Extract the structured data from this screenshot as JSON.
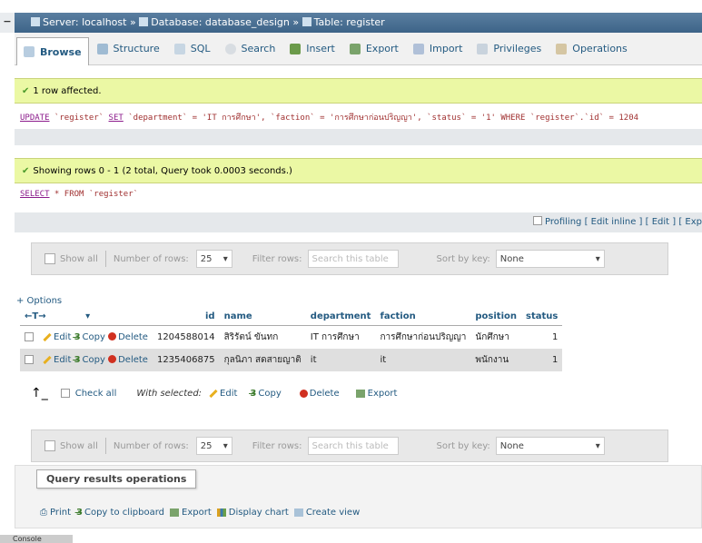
{
  "breadcrumb": {
    "server": "Server: localhost",
    "database": "Database: database_design",
    "table": "Table: register",
    "separator": "»"
  },
  "tabs": [
    {
      "label": "Browse",
      "icon": "browse-icon"
    },
    {
      "label": "Structure",
      "icon": "structure-icon"
    },
    {
      "label": "SQL",
      "icon": "sql-icon"
    },
    {
      "label": "Search",
      "icon": "search-icon"
    },
    {
      "label": "Insert",
      "icon": "insert-icon"
    },
    {
      "label": "Export",
      "icon": "export-icon"
    },
    {
      "label": "Import",
      "icon": "import-icon"
    },
    {
      "label": "Privileges",
      "icon": "privileges-icon"
    },
    {
      "label": "Operations",
      "icon": "operations-icon"
    }
  ],
  "update_msg": {
    "text": "1 row affected.",
    "sql_kw": "UPDATE",
    "sql_rest": " `register` ",
    "sql_kw2": "SET",
    "sql_tail": " `department` = 'IT การศึกษา', `faction` = 'การศึกษาก่อนปริญญา', `status` = '1' WHERE `register`.`id` = 1204"
  },
  "select_msg": {
    "text": "Showing rows 0 - 1 (2 total, Query took 0.0003 seconds.)",
    "sql_kw": "SELECT",
    "sql_rest": " * FROM `register`"
  },
  "profiling": {
    "label": "Profiling",
    "links": "[ Edit inline ] [ Edit ] [ Exp"
  },
  "nav": {
    "show_all": "Show all",
    "number_of_rows_label": "Number of rows:",
    "number_of_rows": "25",
    "filter_rows_label": "Filter rows:",
    "filter_placeholder": "Search this table",
    "sort_by_key_label": "Sort by key:",
    "sort_by_key": "None"
  },
  "options_label": "+ Options",
  "columns": [
    "id",
    "name",
    "department",
    "faction",
    "position",
    "status"
  ],
  "rows": [
    {
      "id": "1204588014",
      "name": "สิริรัตน์ ขันทก",
      "department": "IT การศึกษา",
      "faction": "การศึกษาก่อนปริญญา",
      "position": "นักศึกษา",
      "status": "1"
    },
    {
      "id": "1235406875",
      "name": "กุลนิภา สดสายญาติ",
      "department": "it",
      "faction": "it",
      "position": "พนักงาน",
      "status": "1"
    }
  ],
  "row_actions": {
    "edit": "Edit",
    "copy": "Copy",
    "delete": "Delete"
  },
  "bulk": {
    "check_all": "Check all",
    "with_selected": "With selected:",
    "edit": "Edit",
    "copy": "Copy",
    "delete": "Delete",
    "export": "Export"
  },
  "query_ops": {
    "title": "Query results operations",
    "print": "Print",
    "copy_clipboard": "Copy to clipboard",
    "export": "Export",
    "display_chart": "Display chart",
    "create_view": "Create view"
  },
  "console": "Console"
}
